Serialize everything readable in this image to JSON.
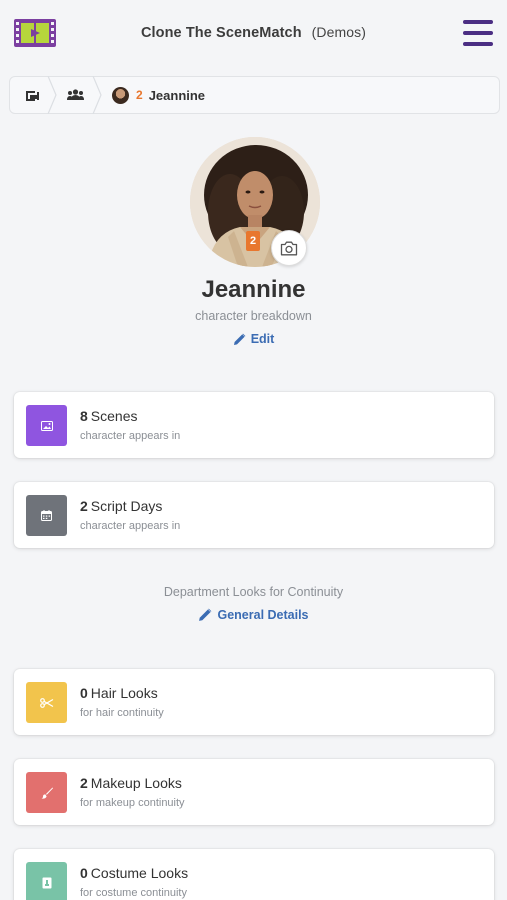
{
  "header": {
    "title": "Clone The SceneMatch",
    "demos": "(Demos)",
    "logo_icon": "film-strip-logo",
    "menu_icon": "hamburger-menu-icon"
  },
  "breadcrumb": {
    "home_icon": "home-icon",
    "group_icon": "users-icon",
    "character_number": "2",
    "character_name": "Jeannine"
  },
  "profile": {
    "name": "Jeannine",
    "subtitle": "character breakdown",
    "edit_label": "Edit",
    "badge_number": "2",
    "camera_icon": "camera-icon"
  },
  "stats": [
    {
      "count": "8",
      "label": "Scenes",
      "sub": "character appears in",
      "color": "#8f55e0",
      "icon": "image-icon"
    },
    {
      "count": "2",
      "label": "Script Days",
      "sub": "character appears in",
      "color": "#6f737a",
      "icon": "calendar-icon"
    }
  ],
  "department": {
    "label": "Department Looks for Continuity",
    "general_label": "General Details"
  },
  "looks": [
    {
      "count": "0",
      "label": "Hair Looks",
      "sub": "for hair continuity",
      "color": "#f2c44c",
      "icon": "scissors-icon"
    },
    {
      "count": "2",
      "label": "Makeup Looks",
      "sub": "for makeup continuity",
      "color": "#e2706e",
      "icon": "brush-icon"
    },
    {
      "count": "0",
      "label": "Costume Looks",
      "sub": "for costume continuity",
      "color": "#79c3a7",
      "icon": "shirt-icon"
    }
  ],
  "colors": {
    "accent": "#4b2e83",
    "link": "#3b6cb3",
    "orange": "#e8772e"
  }
}
